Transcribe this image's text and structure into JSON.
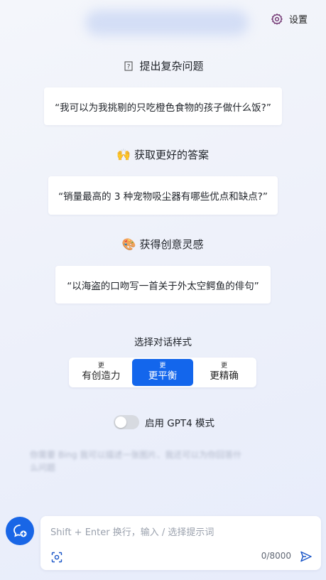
{
  "header": {
    "settings_label": "设置"
  },
  "sections": [
    {
      "icon": "question-icon",
      "title": "提出复杂问题",
      "example": "“我可以为我挑剔的只吃橙色食物的孩子做什么饭?”"
    },
    {
      "icon": "raised-hands-icon",
      "title": "获取更好的答案",
      "example": "“销量最高的 3 种宠物吸尘器有哪些优点和缺点?”"
    },
    {
      "icon": "palette-icon",
      "title": "获得创意灵感",
      "example": "“以海盗的口吻写一首关于外太空鳄鱼的俳句”"
    }
  ],
  "style_picker": {
    "label": "选择对话样式",
    "options": [
      {
        "small": "更",
        "big": "有创造力"
      },
      {
        "small": "更",
        "big": "更平衡"
      },
      {
        "small": "更",
        "big": "更精确"
      }
    ],
    "selected": 1
  },
  "gpt4_toggle": {
    "label": "启用 GPT4 模式",
    "on": false
  },
  "hint_blurred": "你需要 Bing 我可以描述一张图片、我还可以为你回答什么问题",
  "input": {
    "placeholder": "Shift + Enter 换行，输入 / 选择提示词",
    "counter": "0/8000"
  },
  "colors": {
    "accent": "#1366ec",
    "background": "#eef1fa"
  }
}
